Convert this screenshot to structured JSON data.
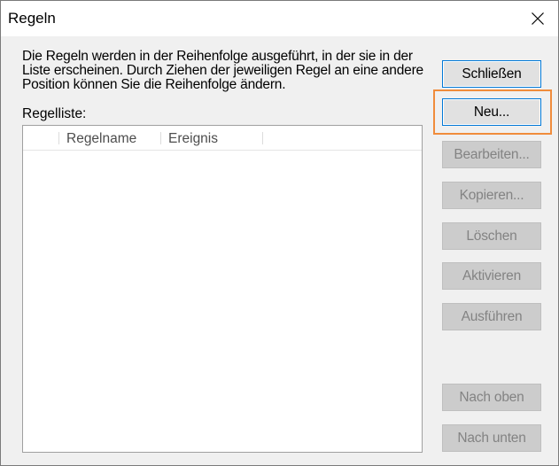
{
  "window": {
    "title": "Regeln"
  },
  "icons": {
    "close": "close-icon"
  },
  "description": "Die Regeln werden in der Reihenfolge ausgeführt, in der sie in der Liste erscheinen. Durch Ziehen der jeweiligen Regel an eine andere Position können Sie die Reihenfolge ändern.",
  "list": {
    "label": "Regelliste:",
    "columns": [
      "Regelname",
      "Ereignis"
    ],
    "rows": []
  },
  "buttons": {
    "close": "Schließen",
    "new": "Neu...",
    "edit": "Bearbeiten...",
    "copy": "Kopieren...",
    "delete": "Löschen",
    "activate": "Aktivieren",
    "run": "Ausführen",
    "move_up": "Nach oben",
    "move_down": "Nach unten"
  },
  "colors": {
    "focus_highlight": "#f08c3c",
    "default_button_border": "#0078d7",
    "disabled_text": "#838383"
  }
}
